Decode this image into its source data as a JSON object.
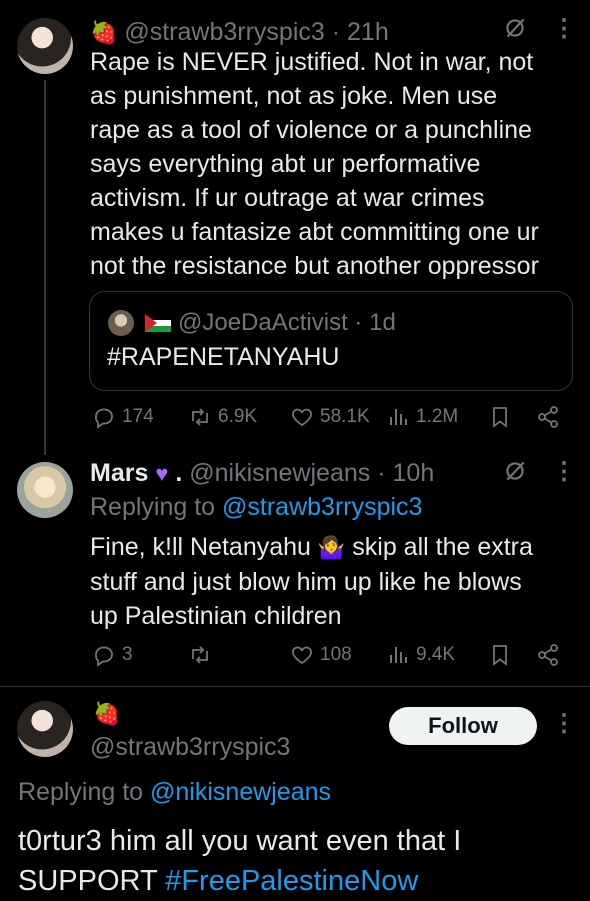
{
  "tweet1": {
    "handle": "@strawb3rryspic3",
    "sep": "·",
    "time": "21h",
    "lines": [
      "Rape is NEVER justified. Not in war, not",
      "as punishment, not as joke. Men use",
      "rape as a tool of violence or a punchline",
      "says everything abt ur performative",
      "activism. If ur outrage at war crimes",
      "makes u fantasize abt committing one ur",
      "not the resistance but another oppressor"
    ],
    "quote": {
      "handle": "@JoeDaActivist",
      "sep": "·",
      "time": "1d",
      "text": "#RAPENETANYAHU"
    },
    "stats": {
      "replies": "174",
      "reposts": "6.9K",
      "likes": "58.1K",
      "views": "1.2M"
    }
  },
  "tweet2": {
    "name": "Mars",
    "dot": ".",
    "handle": "@nikisnewjeans",
    "sep": "·",
    "time": "10h",
    "replying_prefix": "Replying to",
    "replying_to": "@strawb3rryspic3",
    "line1a": "Fine, k!ll Netanyahu",
    "line1b": "skip all the extra",
    "line2": "stuff and just blow him up like he blows",
    "line3": "up Palestinian children",
    "stats": {
      "replies": "3",
      "reposts": "",
      "likes": "108",
      "views": "9.4K"
    }
  },
  "tweet3": {
    "handle": "@strawb3rryspic3",
    "follow_label": "Follow",
    "replying_prefix": "Replying to",
    "replying_to": "@nikisnewjeans",
    "line1": "t0rtur3 him all you want even that I",
    "line2_text": "SUPPORT",
    "line2_tag": "#FreePalestineNow"
  },
  "colors": {
    "background": "#000000",
    "text": "#e7e9ea",
    "muted": "#71767b",
    "link": "#1d9bf0"
  },
  "icons": [
    "strawberry-emoji",
    "purple-heart-emoji",
    "person-shrugging-emoji",
    "palestine-flag",
    "grok-icon",
    "more-icon",
    "reply-icon",
    "repost-icon",
    "like-icon",
    "views-icon",
    "bookmark-icon",
    "share-icon"
  ]
}
